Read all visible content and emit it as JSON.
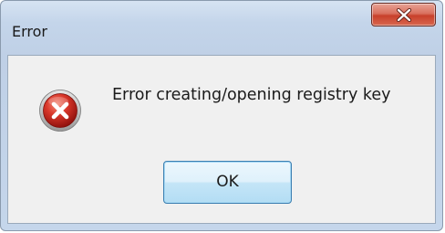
{
  "window": {
    "title": "Error"
  },
  "dialog": {
    "icon": "error-icon",
    "message": "Error creating/opening registry key",
    "ok_label": "OK"
  },
  "colors": {
    "close_button": "#c8402b",
    "error_icon": "#c8211b",
    "ok_border": "#3c7fb1"
  }
}
